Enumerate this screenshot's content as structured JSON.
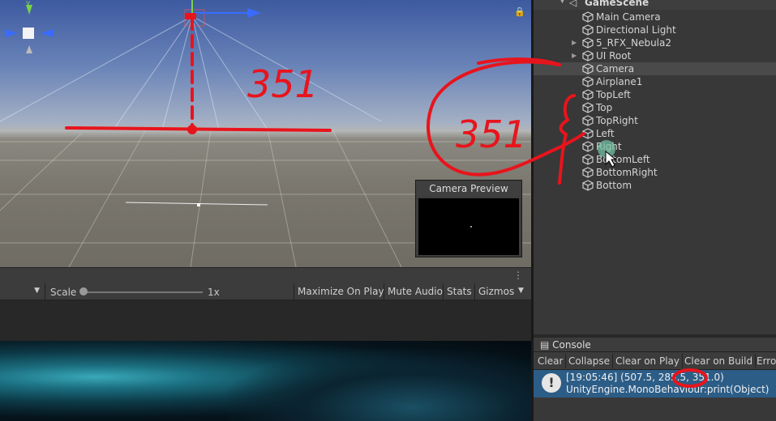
{
  "scene_view": {
    "lock_icon": "lock-icon",
    "gizmo_axes": {
      "y": "y"
    },
    "camera_preview_title": "Camera Preview"
  },
  "game_toolbar": {
    "scale_label": "Scale",
    "scale_value": "1x",
    "buttons": [
      "Maximize On Play",
      "Mute Audio",
      "Stats",
      "Gizmos"
    ]
  },
  "hierarchy": {
    "scene_name": "GameScene",
    "items": [
      {
        "label": "Main Camera",
        "foldable": false
      },
      {
        "label": "Directional Light",
        "foldable": false
      },
      {
        "label": "5_RFX_Nebula2",
        "foldable": true
      },
      {
        "label": "UI Root",
        "foldable": true
      },
      {
        "label": "Camera",
        "foldable": false,
        "selected": true
      },
      {
        "label": "Airplane1",
        "foldable": false
      },
      {
        "label": "TopLeft",
        "foldable": false
      },
      {
        "label": "Top",
        "foldable": false
      },
      {
        "label": "TopRight",
        "foldable": false
      },
      {
        "label": "Left",
        "foldable": false
      },
      {
        "label": "Right",
        "foldable": false
      },
      {
        "label": "BottomLeft",
        "foldable": false
      },
      {
        "label": "BottomRight",
        "foldable": false
      },
      {
        "label": "Bottom",
        "foldable": false
      }
    ]
  },
  "console": {
    "tab_label": "Console",
    "toolbar": [
      "Clear",
      "Collapse",
      "Clear on Play",
      "Clear on Build",
      "Error"
    ],
    "entry_line1": "[19:05:46] (507.5, 285.5, 351.0)",
    "entry_line2": "UnityEngine.MonoBehaviour:print(Object)"
  },
  "annotations": {
    "handwritten_1": "351",
    "handwritten_2": "351",
    "color": "#e8141c"
  }
}
